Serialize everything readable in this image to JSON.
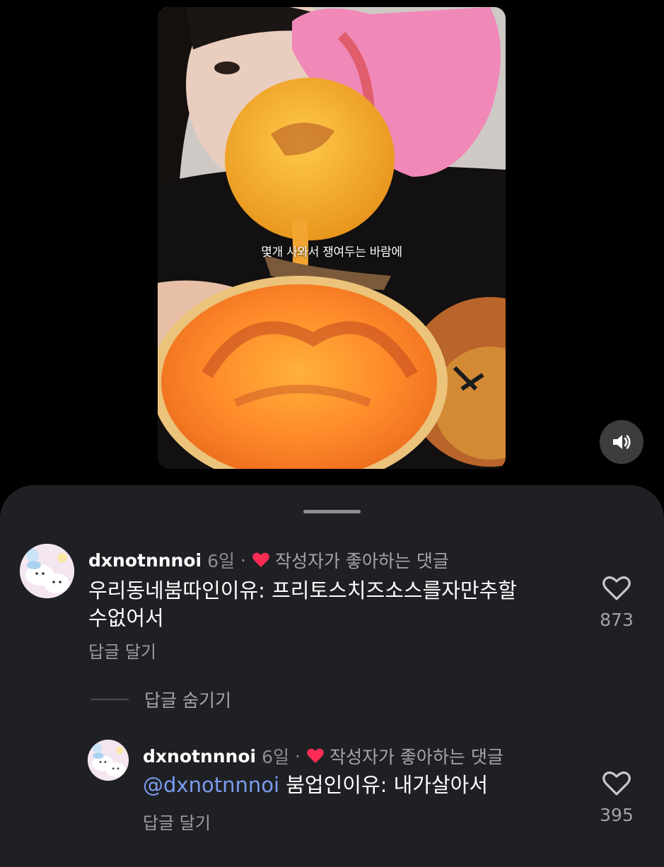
{
  "video": {
    "caption": "몇개 사와서 쟁여두는 바람에",
    "mute_icon": "speaker-volume-icon"
  },
  "comments": [
    {
      "username": "dxnotnnnoi",
      "time": "6일",
      "separator": "·",
      "liked_label": "작성자가 좋아하는 댓글",
      "text_line1": "우리동네붐따인이유: 프리토스치즈소스를자만추할",
      "text_line2": "수없어서",
      "reply_label": "답글 달기",
      "like_count": "873"
    }
  ],
  "hide_replies_label": "답글 숨기기",
  "replies": [
    {
      "username": "dxnotnnnoi",
      "time": "6일",
      "separator": "·",
      "liked_label": "작성자가 좋아하는 댓글",
      "mention": "@dxnotnnnoi",
      "text": "붐업인이유: 내가살아서",
      "reply_label": "답글 달기",
      "like_count": "395"
    }
  ],
  "colors": {
    "sheet_bg": "#1f2024",
    "heart_red": "#fe2c55",
    "mention_blue": "#7b9bee"
  }
}
